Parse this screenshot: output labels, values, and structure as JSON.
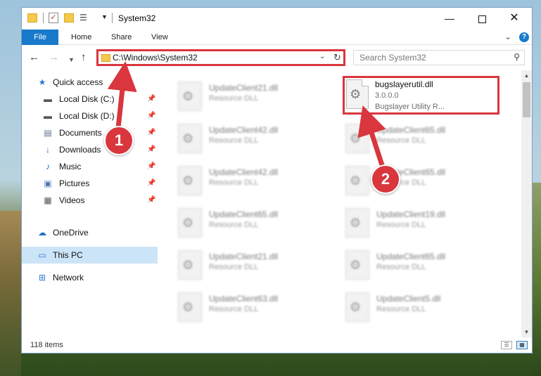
{
  "window": {
    "title": "System32",
    "qa_props_glyph": "✓",
    "qa_view_glyph": "☰",
    "qa_down_glyph": "▼",
    "minimize_glyph": "—",
    "close_glyph": "✕"
  },
  "ribbon": {
    "tabs": [
      {
        "label": "File"
      },
      {
        "label": "Home"
      },
      {
        "label": "Share"
      },
      {
        "label": "View"
      }
    ],
    "expand_glyph": "⌄",
    "help_glyph": "?"
  },
  "nav": {
    "back_glyph": "←",
    "forward_glyph": "→",
    "recent_glyph": "▼",
    "up_glyph": "↑",
    "address": "C:\\Windows\\System32",
    "address_dropdown_glyph": "⌄",
    "refresh_glyph": "↻",
    "search_placeholder": "Search System32",
    "search_glyph": "⚲"
  },
  "sidebar": {
    "items": [
      {
        "label": "Quick access",
        "icon": "star-icon",
        "glyph": "★",
        "pinned": false
      },
      {
        "label": "Local Disk (C:)",
        "icon": "drive-icon",
        "glyph": "▬",
        "pinned": true
      },
      {
        "label": "Local Disk (D:)",
        "icon": "drive-icon",
        "glyph": "▬",
        "pinned": true
      },
      {
        "label": "Documents",
        "icon": "documents-icon",
        "glyph": "▤",
        "pinned": true
      },
      {
        "label": "Downloads",
        "icon": "download-icon",
        "glyph": "↓",
        "pinned": true
      },
      {
        "label": "Music",
        "icon": "music-icon",
        "glyph": "♪",
        "pinned": true
      },
      {
        "label": "Pictures",
        "icon": "pictures-icon",
        "glyph": "▣",
        "pinned": true
      },
      {
        "label": "Videos",
        "icon": "videos-icon",
        "glyph": "▦",
        "pinned": true
      },
      {
        "label": "OneDrive",
        "icon": "cloud-icon",
        "glyph": "☁",
        "pinned": false
      },
      {
        "label": "This PC",
        "icon": "computer-icon",
        "glyph": "▭",
        "pinned": false,
        "selected": true
      },
      {
        "label": "Network",
        "icon": "network-icon",
        "glyph": "⊞",
        "pinned": false
      }
    ],
    "pin_glyph": "📌"
  },
  "files": {
    "gear_glyph": "⚙",
    "left_column": [
      {
        "name": "UpdateClient21.dll",
        "type": "Resource DLL"
      },
      {
        "name": "UpdateClient42.dll",
        "type": "Resource DLL"
      },
      {
        "name": "UpdateClient42.dll",
        "type": "Resource DLL"
      },
      {
        "name": "UpdateClient65.dll",
        "type": "Resource DLL"
      },
      {
        "name": "UpdateClient21.dll",
        "type": "Resource DLL"
      },
      {
        "name": "UpdateClient63.dll",
        "type": "Resource DLL"
      }
    ],
    "right_column": [
      {
        "name": "UpdateClient65.dll",
        "type": "Resource DLL"
      },
      {
        "name": "UpdateClient65.dll",
        "type": "Resource DLL"
      },
      {
        "name": "UpdateClient19.dll",
        "type": "Resource DLL"
      },
      {
        "name": "UpdateClient65.dll",
        "type": "Resource DLL"
      },
      {
        "name": "UpdateClient5.dll",
        "type": "Resource DLL"
      }
    ],
    "highlighted": {
      "name": "bugslayerutil.dll",
      "version": "3.0.0.0",
      "description": "Bugslayer Utility R..."
    }
  },
  "scrollbar": {
    "up_glyph": "▲",
    "down_glyph": "▼"
  },
  "status": {
    "count": "118 items",
    "details_glyph": "☰",
    "tiles_glyph": "▦"
  },
  "annotations": {
    "step1": "1",
    "step2": "2",
    "color": "#d9363e"
  }
}
